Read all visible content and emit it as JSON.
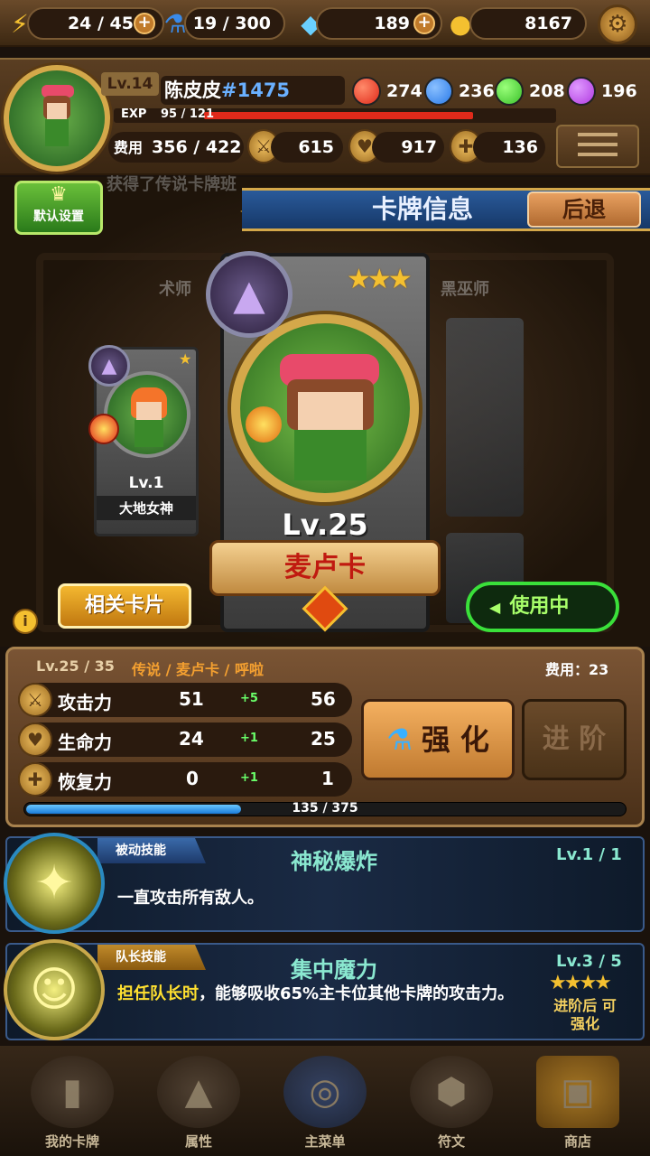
{
  "resources": {
    "energy": "24 / 45",
    "potion": "19 / 300",
    "gems": "189",
    "gold": "8167"
  },
  "player": {
    "level": "Lv.14",
    "name": "陈皮皮",
    "id": "#1475",
    "exp_label": "EXP",
    "exp_value": "95 / 121",
    "exp_fraction": 0.785,
    "orbs": [
      {
        "value": "274",
        "color": "#e02a1a"
      },
      {
        "value": "236",
        "color": "#2a7ae8"
      },
      {
        "value": "208",
        "color": "#3ac02a"
      },
      {
        "value": "196",
        "color": "#b03ae0"
      }
    ],
    "cost_label": "费用",
    "cost": "356 / 422",
    "attack": "615",
    "hp": "917",
    "recovery": "136"
  },
  "default_button": "默认设置",
  "header": {
    "title": "卡牌信息",
    "back": "后退"
  },
  "side_card": {
    "level": "Lv.1",
    "name": "大地女神"
  },
  "card": {
    "level": "Lv.25",
    "name": "麦卢卡",
    "stars": "★★★"
  },
  "related_button": "相关卡片",
  "in_use_button": "使用中",
  "stats": {
    "level_range": "Lv.25 / 35",
    "tags": "传说 / 麦卢卡 / 呼啦",
    "cost": "费用：23",
    "rows": [
      {
        "label": "攻击力",
        "current": "51",
        "delta": "+5",
        "next": "56"
      },
      {
        "label": "生命力",
        "current": "24",
        "delta": "+1",
        "next": "25"
      },
      {
        "label": "恢复力",
        "current": "0",
        "delta": "+1",
        "next": "1"
      }
    ],
    "progress": "135 / 375",
    "progress_fraction": 0.36,
    "enhance": "强 化",
    "advance": "进 阶"
  },
  "skills": [
    {
      "tag": "被动技能",
      "name": "神秘爆炸",
      "level": "Lv.1 / 1",
      "desc": "一直攻击所有敌人。"
    },
    {
      "tag": "队长技能",
      "name": "集中魔力",
      "level": "Lv.3 / 5",
      "desc_highlight": "担任队长时",
      "desc": "，能够吸收65%主卡位其他卡牌的攻击力。",
      "stars": "★★★★",
      "note": "进阶后 可强化"
    }
  ],
  "nav": [
    "我的卡牌",
    "属性",
    "主菜单",
    "符文",
    "商店"
  ],
  "background_text": {
    "marquee": "获得了传说卡牌班",
    "left_label": "术师",
    "right_label": "黑巫师"
  }
}
